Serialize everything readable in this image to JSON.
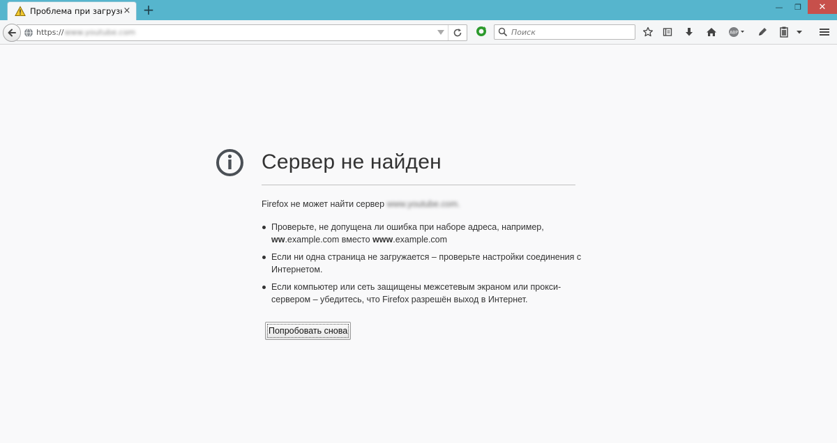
{
  "window": {
    "tab_title": "Проблема при загрузке ...",
    "tab_close_glyph": "×",
    "new_tab_glyph": "+",
    "minimize_glyph": "—",
    "maximize_glyph": "❐",
    "close_glyph": "✕"
  },
  "navbar": {
    "url_scheme": "https://",
    "url_host": "www.youtube.com",
    "search_placeholder": "Поиск"
  },
  "error": {
    "title": "Сервер не найден",
    "description_prefix": "Firefox не может найти сервер",
    "description_host": "www.youtube.com.",
    "tips": {
      "tip1_text_a": "Проверьте, не допущена ли ошибка при наборе адреса, например,",
      "tip1_bold_a": "ww",
      "tip1_text_b": ".example.com вместо",
      "tip1_bold_b": "www",
      "tip1_text_c": ".example.com",
      "tip2": "Если ни одна страница не загружается – проверьте настройки соединения с Интернетом.",
      "tip3": "Если компьютер или сеть защищены межсетевым экраном или прокси-сервером – убедитесь, что Firefox разрешён выход в Интернет."
    },
    "retry_label": "Попробовать снова"
  },
  "colors": {
    "titlebar": "#56b5cd",
    "window_close": "#c7504b",
    "page_background": "#f9f9fa",
    "text": "#333333"
  },
  "icons": {
    "tab": "warning-icon",
    "back": "back-arrow-icon",
    "site": "globe-icon",
    "reload": "reload-icon",
    "extension": "green-extension-icon",
    "search": "search-icon",
    "toolbar": [
      "bookmark-star-icon",
      "reading-list-icon",
      "download-icon",
      "home-icon",
      "adblock-icon",
      "pen-icon",
      "clipboard-icon",
      "menu-icon"
    ],
    "error": "info-icon"
  }
}
